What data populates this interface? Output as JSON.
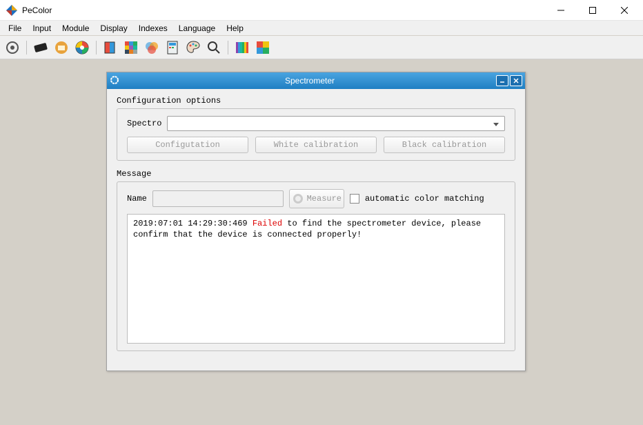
{
  "app": {
    "title": "PeColor"
  },
  "menu": {
    "items": [
      "File",
      "Input",
      "Module",
      "Display",
      "Indexes",
      "Language",
      "Help"
    ]
  },
  "dialog": {
    "title": "Spectrometer",
    "config_label": "Configuration options",
    "spectro_label": "Spectro",
    "config_btn": "Configutation",
    "white_btn": "White calibration",
    "black_btn": "Black calibration",
    "message_label": "Message",
    "name_label": "Name",
    "measure_btn": "Measure",
    "auto_match": "automatic color matching",
    "log": {
      "timestamp": "2019:07:01 14:29:30:469",
      "failed": "Failed",
      "text": " to find the spectrometer device, please confirm that the device is connected properly!"
    }
  }
}
